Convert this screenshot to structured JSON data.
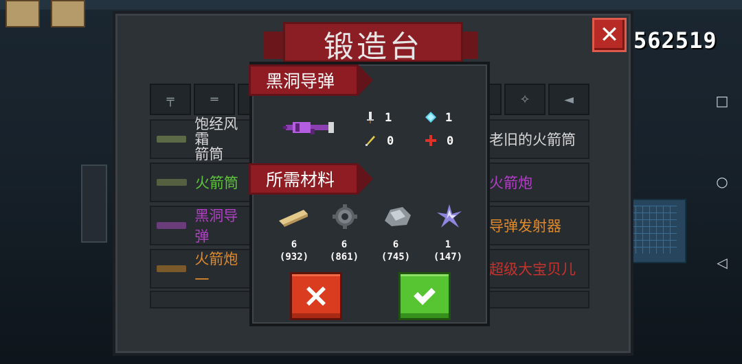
{
  "coins": "562519",
  "title": "锻造台",
  "tabs": [
    "",
    "",
    "",
    "",
    "",
    ""
  ],
  "weapons_left": [
    {
      "name": "饱经风霜",
      "name2": "箭筒",
      "color": "#d8d8d8"
    },
    {
      "name": "火箭筒",
      "color": "#5ec43a"
    },
    {
      "name": "黑洞导弹",
      "color": "#b43ec7"
    },
    {
      "name": "火箭炮一",
      "color": "#e08a2a"
    }
  ],
  "weapons_right": [
    {
      "name": "老旧的火箭筒",
      "color": "#d8d8d8"
    },
    {
      "name": "火箭炮",
      "color": "#b43ec7"
    },
    {
      "name": "导弹发射器",
      "color": "#e08a2a"
    },
    {
      "name": "超级大宝贝儿",
      "color": "#c8322c"
    }
  ],
  "popup": {
    "weapon_name": "黑洞导弹",
    "materials_header": "所需材料",
    "stats": {
      "damage": "1",
      "energy": "1",
      "crit": "0",
      "spread": "0"
    },
    "materials": [
      {
        "icon": "wood-plank-icon",
        "need": "6",
        "have": "(932)"
      },
      {
        "icon": "gear-icon",
        "need": "6",
        "have": "(861)"
      },
      {
        "icon": "ore-icon",
        "need": "6",
        "have": "(745)"
      },
      {
        "icon": "crystal-shard-icon",
        "need": "1",
        "have": "(147)"
      }
    ]
  },
  "colors": {
    "banner": "#8a1e24",
    "cancel": "#d93c1f",
    "confirm": "#56c531"
  }
}
